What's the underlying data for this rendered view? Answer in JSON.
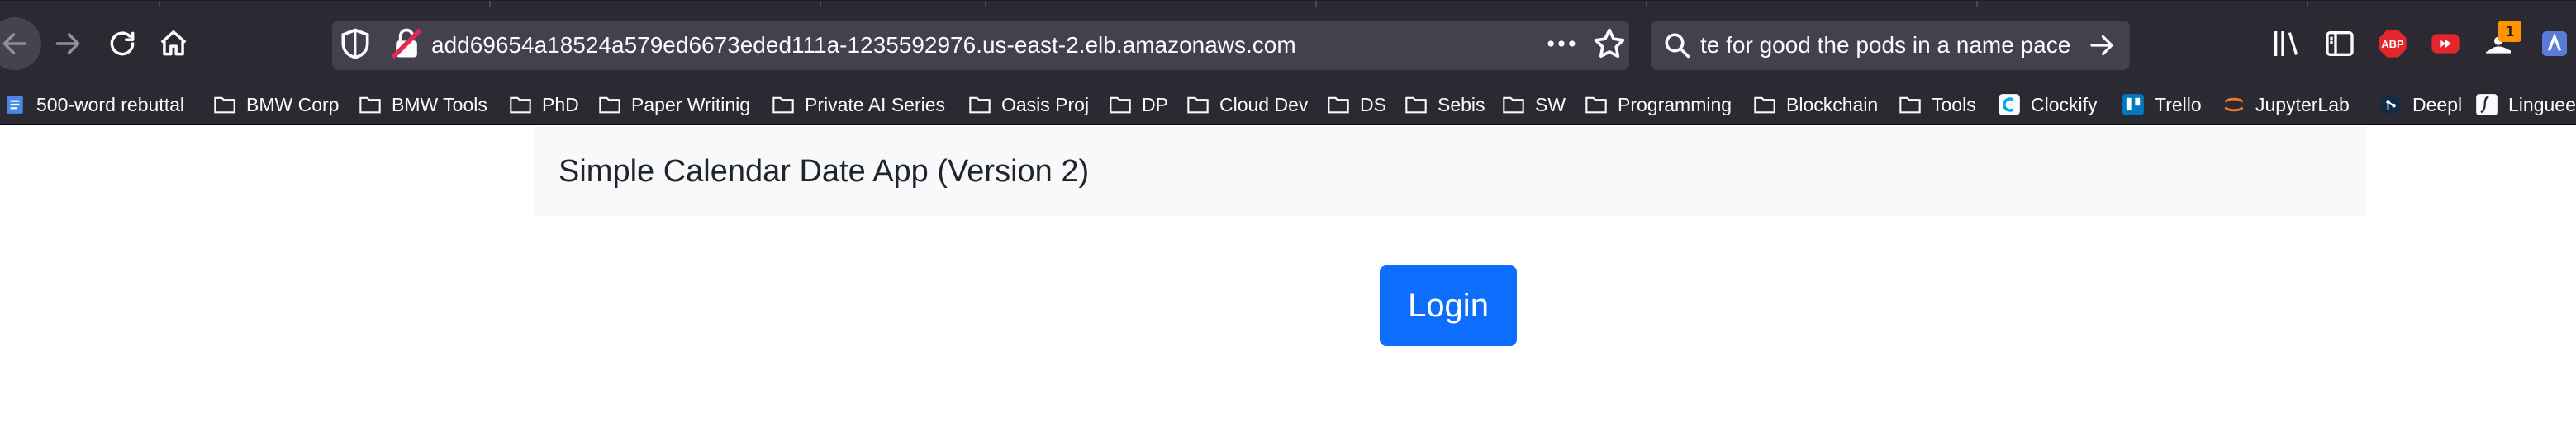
{
  "browser": {
    "url": "add69654a18524a579ed6673eded111a-1235592976.us-east-2.elb.amazonaws.com",
    "search_text": "te for good the pods in a name pace",
    "extension_badge": "1",
    "abp_label": "ABP",
    "accent_color": "#0d6efd"
  },
  "bookmarks": [
    {
      "label": "500-word rebuttal",
      "icon": "doc-icon"
    },
    {
      "label": "BMW Corp",
      "icon": "folder-icon"
    },
    {
      "label": "BMW Tools",
      "icon": "folder-icon"
    },
    {
      "label": "PhD",
      "icon": "folder-icon"
    },
    {
      "label": "Paper Writinig",
      "icon": "folder-icon"
    },
    {
      "label": "Private AI Series",
      "icon": "folder-icon"
    },
    {
      "label": "Oasis Proj",
      "icon": "folder-icon"
    },
    {
      "label": "DP",
      "icon": "folder-icon"
    },
    {
      "label": "Cloud Dev",
      "icon": "folder-icon"
    },
    {
      "label": "DS",
      "icon": "folder-icon"
    },
    {
      "label": "Sebis",
      "icon": "folder-icon"
    },
    {
      "label": "SW",
      "icon": "folder-icon"
    },
    {
      "label": "Programming",
      "icon": "folder-icon"
    },
    {
      "label": "Blockchain",
      "icon": "folder-icon"
    },
    {
      "label": "Tools",
      "icon": "folder-icon"
    },
    {
      "label": "Clockify",
      "icon": "clockify-icon"
    },
    {
      "label": "Trello",
      "icon": "trello-icon"
    },
    {
      "label": "JupyterLab",
      "icon": "jupyter-icon"
    },
    {
      "label": "Deepl",
      "icon": "deepl-icon"
    },
    {
      "label": "Linguee",
      "icon": "linguee-icon"
    }
  ],
  "page": {
    "title": "Simple Calendar Date App (Version 2)",
    "login_label": "Login"
  }
}
